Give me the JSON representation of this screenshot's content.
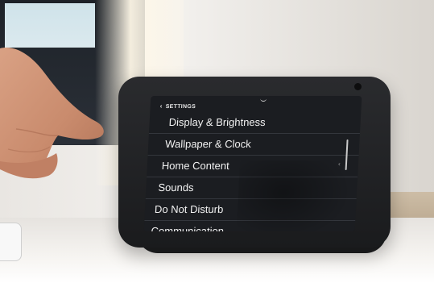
{
  "screen": {
    "header": "SETTINGS",
    "items": [
      {
        "label": "Display & Brightness"
      },
      {
        "label": "Wallpaper & Clock"
      },
      {
        "label": "Home Content"
      },
      {
        "label": "Sounds"
      },
      {
        "label": "Do Not Disturb"
      },
      {
        "label": "Communication"
      }
    ]
  },
  "icons": {
    "back": "chevron-left-icon",
    "pull_down": "chevron-down-icon",
    "camera": "camera-icon"
  }
}
